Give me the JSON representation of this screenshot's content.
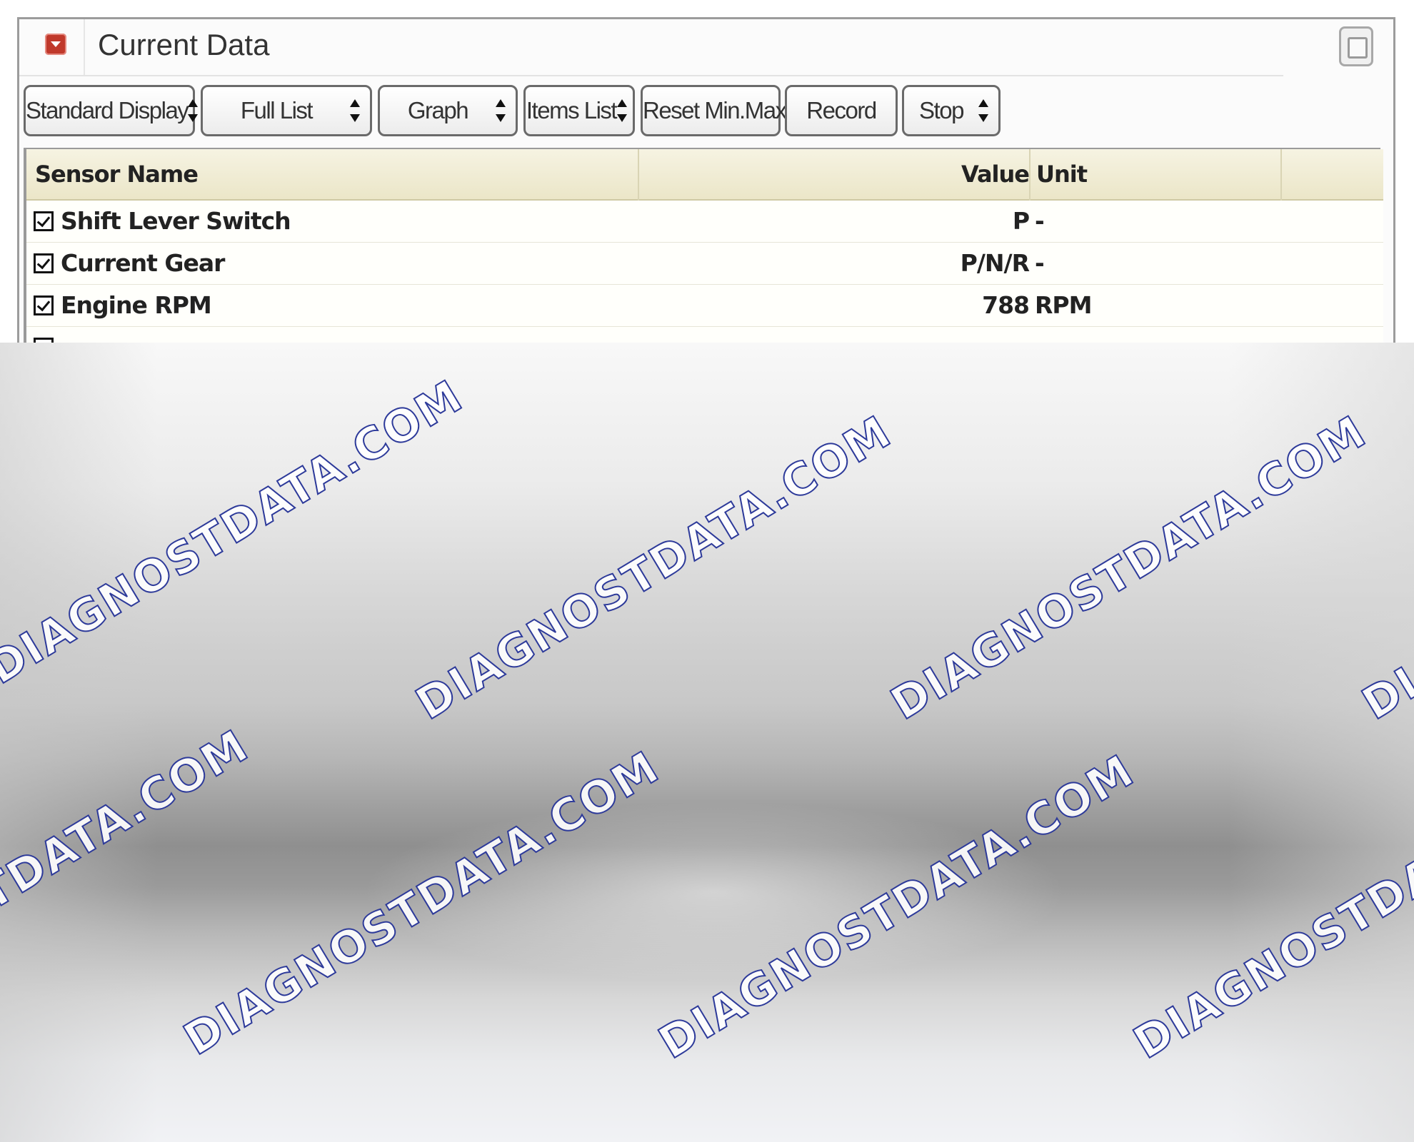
{
  "window": {
    "title": "Current Data"
  },
  "toolbar": {
    "standard_display": "Standard Display",
    "full_list": "Full List",
    "graph": "Graph",
    "items_list": "Items List",
    "reset_min_max": "Reset Min.Max.",
    "record": "Record",
    "stop": "Stop"
  },
  "table": {
    "headers": {
      "sensor_name": "Sensor Name",
      "value": "Value",
      "unit": "Unit"
    },
    "rows": [
      {
        "name": "Shift Lever Switch",
        "value": "P",
        "unit": "-",
        "checked": true
      },
      {
        "name": "Current Gear",
        "value": "P/N/R",
        "unit": "-",
        "checked": true
      },
      {
        "name": "Engine RPM",
        "value": "788",
        "unit": "RPM",
        "checked": true
      }
    ]
  },
  "watermark": {
    "text": "DIAGNOSTDATA.COM"
  },
  "colors": {
    "header_bg": "#f0ecd4",
    "row_bg": "#fffffb",
    "collapse_button": "#c0392b",
    "watermark_outline": "#2d3a9a"
  },
  "icons": {
    "collapse": "collapse-arrow-icon",
    "window": "restore-window-icon",
    "spinner": "spinner-arrows-icon",
    "checkbox": "checkbox-checked-icon"
  }
}
